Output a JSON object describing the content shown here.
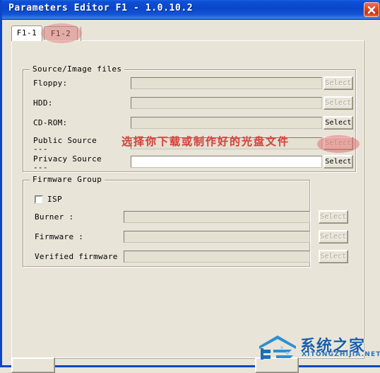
{
  "window": {
    "title": "Parameters Editor F1 - 1.0.10.2",
    "close_icon": "close-icon",
    "accent_color": "#0B46C8",
    "background_color": "#E8E4D8"
  },
  "tabs": [
    {
      "label": "F1-1",
      "active": true
    },
    {
      "label": "F1-2",
      "active": false
    }
  ],
  "annotation": {
    "text": "选择你下载或制作好的光盘文件",
    "color": "#D6453F",
    "highlight_color": "#E26E6E"
  },
  "source_group": {
    "title": "Source/Image files",
    "rows": [
      {
        "label": "Floppy:",
        "value": "",
        "enabled": false,
        "button": "Select",
        "button_enabled": false
      },
      {
        "label": "HDD:",
        "value": "",
        "enabled": false,
        "button": "Select",
        "button_enabled": false
      },
      {
        "label": "CD-ROM:",
        "value": "",
        "enabled": false,
        "button": "Select",
        "button_enabled": true
      },
      {
        "label": "Public Source\n---",
        "value": "",
        "enabled": false,
        "button": "Select",
        "button_enabled": false
      },
      {
        "label": "Privacy Source\n---",
        "value": "",
        "enabled": true,
        "button": "Select",
        "button_enabled": true
      }
    ]
  },
  "firmware_group": {
    "title": "Firmware Group",
    "isp_label": "ISP",
    "isp_checked": false,
    "rows": [
      {
        "label": "Burner :",
        "value": "",
        "enabled": false,
        "button": "Select",
        "button_enabled": false
      },
      {
        "label": "Firmware :",
        "value": "",
        "enabled": false,
        "button": "Select",
        "button_enabled": false
      },
      {
        "label": "Verified firmware :",
        "value": "",
        "enabled": false,
        "button": "Select",
        "button_enabled": false
      }
    ]
  },
  "bottom_buttons": [
    {
      "label": ""
    },
    {
      "label": ""
    }
  ],
  "watermark": {
    "cn": "系统之家",
    "en": "XITONGZHIJIA.NET",
    "color": "#1B5FA8"
  }
}
